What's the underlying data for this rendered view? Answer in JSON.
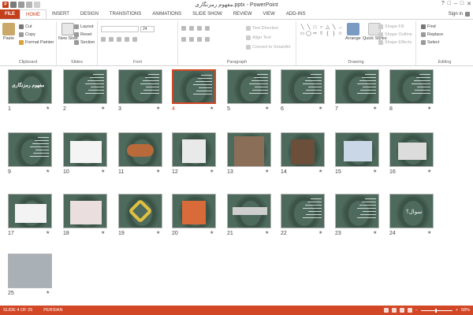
{
  "window": {
    "title": "مفهوم رمزنگاری.pptx - PowerPoint",
    "controls": [
      "?",
      "□",
      "–",
      "□",
      "✕"
    ],
    "sign_in": "Sign in"
  },
  "tabs": [
    "FILE",
    "HOME",
    "INSERT",
    "DESIGN",
    "TRANSITIONS",
    "ANIMATIONS",
    "SLIDE SHOW",
    "REVIEW",
    "VIEW",
    "ADD-INS"
  ],
  "active_tab": "HOME",
  "ribbon": {
    "clipboard": {
      "label": "Clipboard",
      "paste": "Paste",
      "cut": "Cut",
      "copy": "Copy",
      "format_painter": "Format Painter"
    },
    "slides": {
      "label": "Slides",
      "new_slide": "New Slide",
      "layout": "Layout",
      "reset": "Reset",
      "section": "Section"
    },
    "font": {
      "label": "Font",
      "font_name": "",
      "font_size": "24"
    },
    "paragraph": {
      "label": "Paragraph",
      "text_direction": "Text Direction",
      "align_text": "Align Text",
      "convert": "Convert to SmartArt"
    },
    "drawing": {
      "label": "Drawing",
      "arrange": "Arrange",
      "quick_styles": "Quick Styles",
      "shape_fill": "Shape Fill",
      "shape_outline": "Shape Outline",
      "shape_effects": "Shape Effects"
    },
    "editing": {
      "label": "Editing",
      "find": "Find",
      "replace": "Replace",
      "select": "Select"
    }
  },
  "slides": [
    {
      "n": "1",
      "kind": "title",
      "title_text": "مفهوم رمزنگاری"
    },
    {
      "n": "2",
      "kind": "text"
    },
    {
      "n": "3",
      "kind": "text"
    },
    {
      "n": "4",
      "kind": "text",
      "selected": true
    },
    {
      "n": "5",
      "kind": "text"
    },
    {
      "n": "6",
      "kind": "text"
    },
    {
      "n": "7",
      "kind": "text"
    },
    {
      "n": "8",
      "kind": "text"
    },
    {
      "n": "9",
      "kind": "text"
    },
    {
      "n": "10",
      "kind": "diagram"
    },
    {
      "n": "11",
      "kind": "cylinder"
    },
    {
      "n": "12",
      "kind": "wires"
    },
    {
      "n": "13",
      "kind": "machine"
    },
    {
      "n": "14",
      "kind": "box"
    },
    {
      "n": "15",
      "kind": "colors"
    },
    {
      "n": "16",
      "kind": "discs"
    },
    {
      "n": "17",
      "kind": "chart"
    },
    {
      "n": "18",
      "kind": "keys"
    },
    {
      "n": "19",
      "kind": "ring"
    },
    {
      "n": "20",
      "kind": "triangle"
    },
    {
      "n": "21",
      "kind": "band"
    },
    {
      "n": "22",
      "kind": "text"
    },
    {
      "n": "23",
      "kind": "text"
    },
    {
      "n": "24",
      "kind": "question",
      "question_text": "سوال؟"
    },
    {
      "n": "25",
      "kind": "photo"
    }
  ],
  "status": {
    "slide_info": "SLIDE 4 OF 25",
    "language": "PERSIAN",
    "zoom": "58%"
  },
  "colors": {
    "accent": "#d24726",
    "file_tab": "#c43e1c",
    "thumb_bg": "#4d6a5c"
  }
}
